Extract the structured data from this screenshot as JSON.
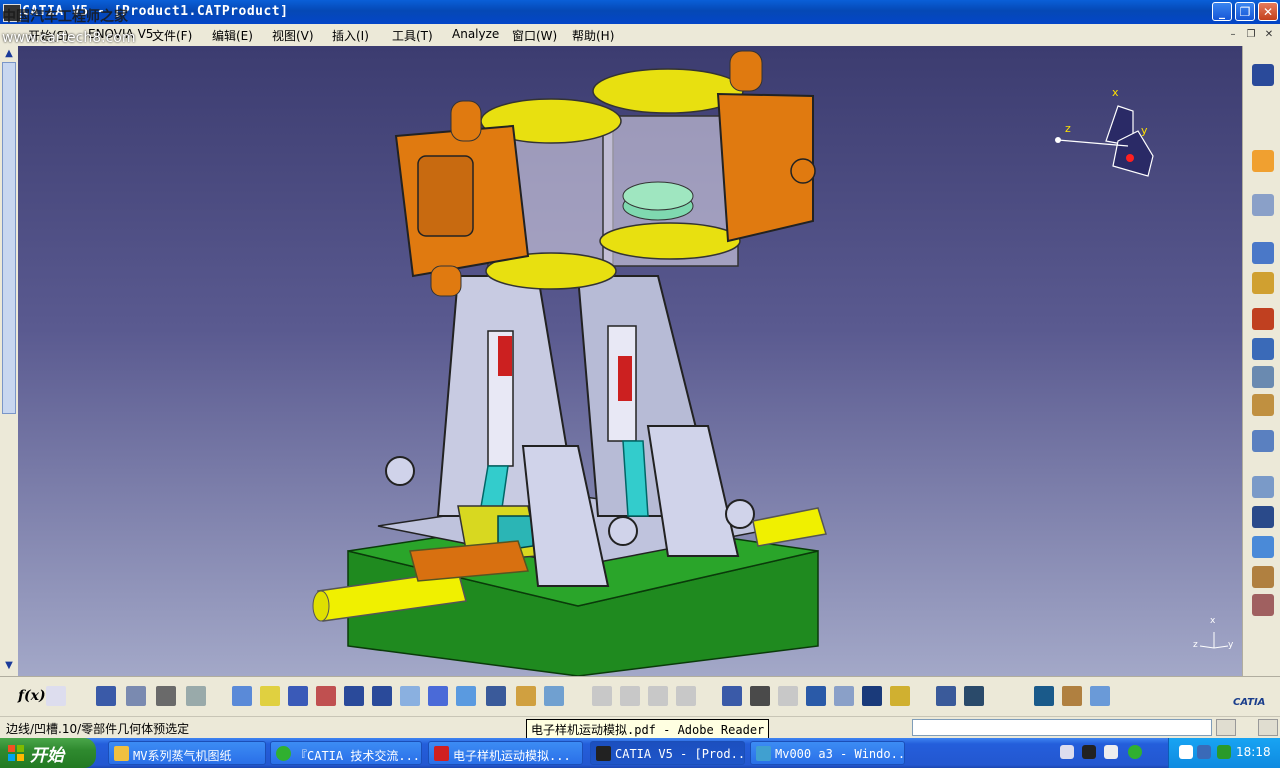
{
  "window": {
    "title": "CATIA V5 - [Product1.CATProduct]",
    "watermark_top": "中国汽车工程师之家",
    "watermark_url": "www.cartech8.com"
  },
  "menu": [
    {
      "label": "开始(S)"
    },
    {
      "label": "ENOVIA V5"
    },
    {
      "label": "文件(F)"
    },
    {
      "label": "编辑(E)"
    },
    {
      "label": "视图(V)"
    },
    {
      "label": "插入(I)"
    },
    {
      "label": "工具(T)"
    },
    {
      "label": "Analyze"
    },
    {
      "label": "窗口(W)"
    },
    {
      "label": "帮助(H)"
    }
  ],
  "compass": {
    "x": "x",
    "y": "y",
    "z": "z"
  },
  "axis_triad": {
    "x": "x",
    "y": "y",
    "z": "z"
  },
  "bottom_toolbar": {
    "formula_label": "f(x)",
    "logo": "CATIA"
  },
  "status": {
    "message": "边线/凹槽.10/零部件几何体预选定",
    "tooltip": "电子样机运动模拟.pdf - Adobe Reader"
  },
  "taskbar": {
    "start_label": "开始",
    "tasks": [
      {
        "label": "MV系列蒸气机图纸",
        "icon": "folder-icon"
      },
      {
        "label": "『CATIA 技术交流...",
        "icon": "browser-icon"
      },
      {
        "label": "电子样机运动模拟...",
        "icon": "pdf-icon"
      },
      {
        "label": "CATIA V5 - [Prod...",
        "icon": "catia-icon"
      },
      {
        "label": "Mv000 a3 - Windo...",
        "icon": "image-viewer-icon"
      }
    ],
    "clock": "18:18"
  },
  "colors": {
    "viewport_top": "#3c3c70",
    "viewport_bottom": "#a3a8c8",
    "part_orange": "#e07a10",
    "part_yellow": "#f0f000",
    "part_green": "#1f8a1f",
    "part_grey": "#b8bcd8",
    "part_cyan": "#33cccc"
  }
}
